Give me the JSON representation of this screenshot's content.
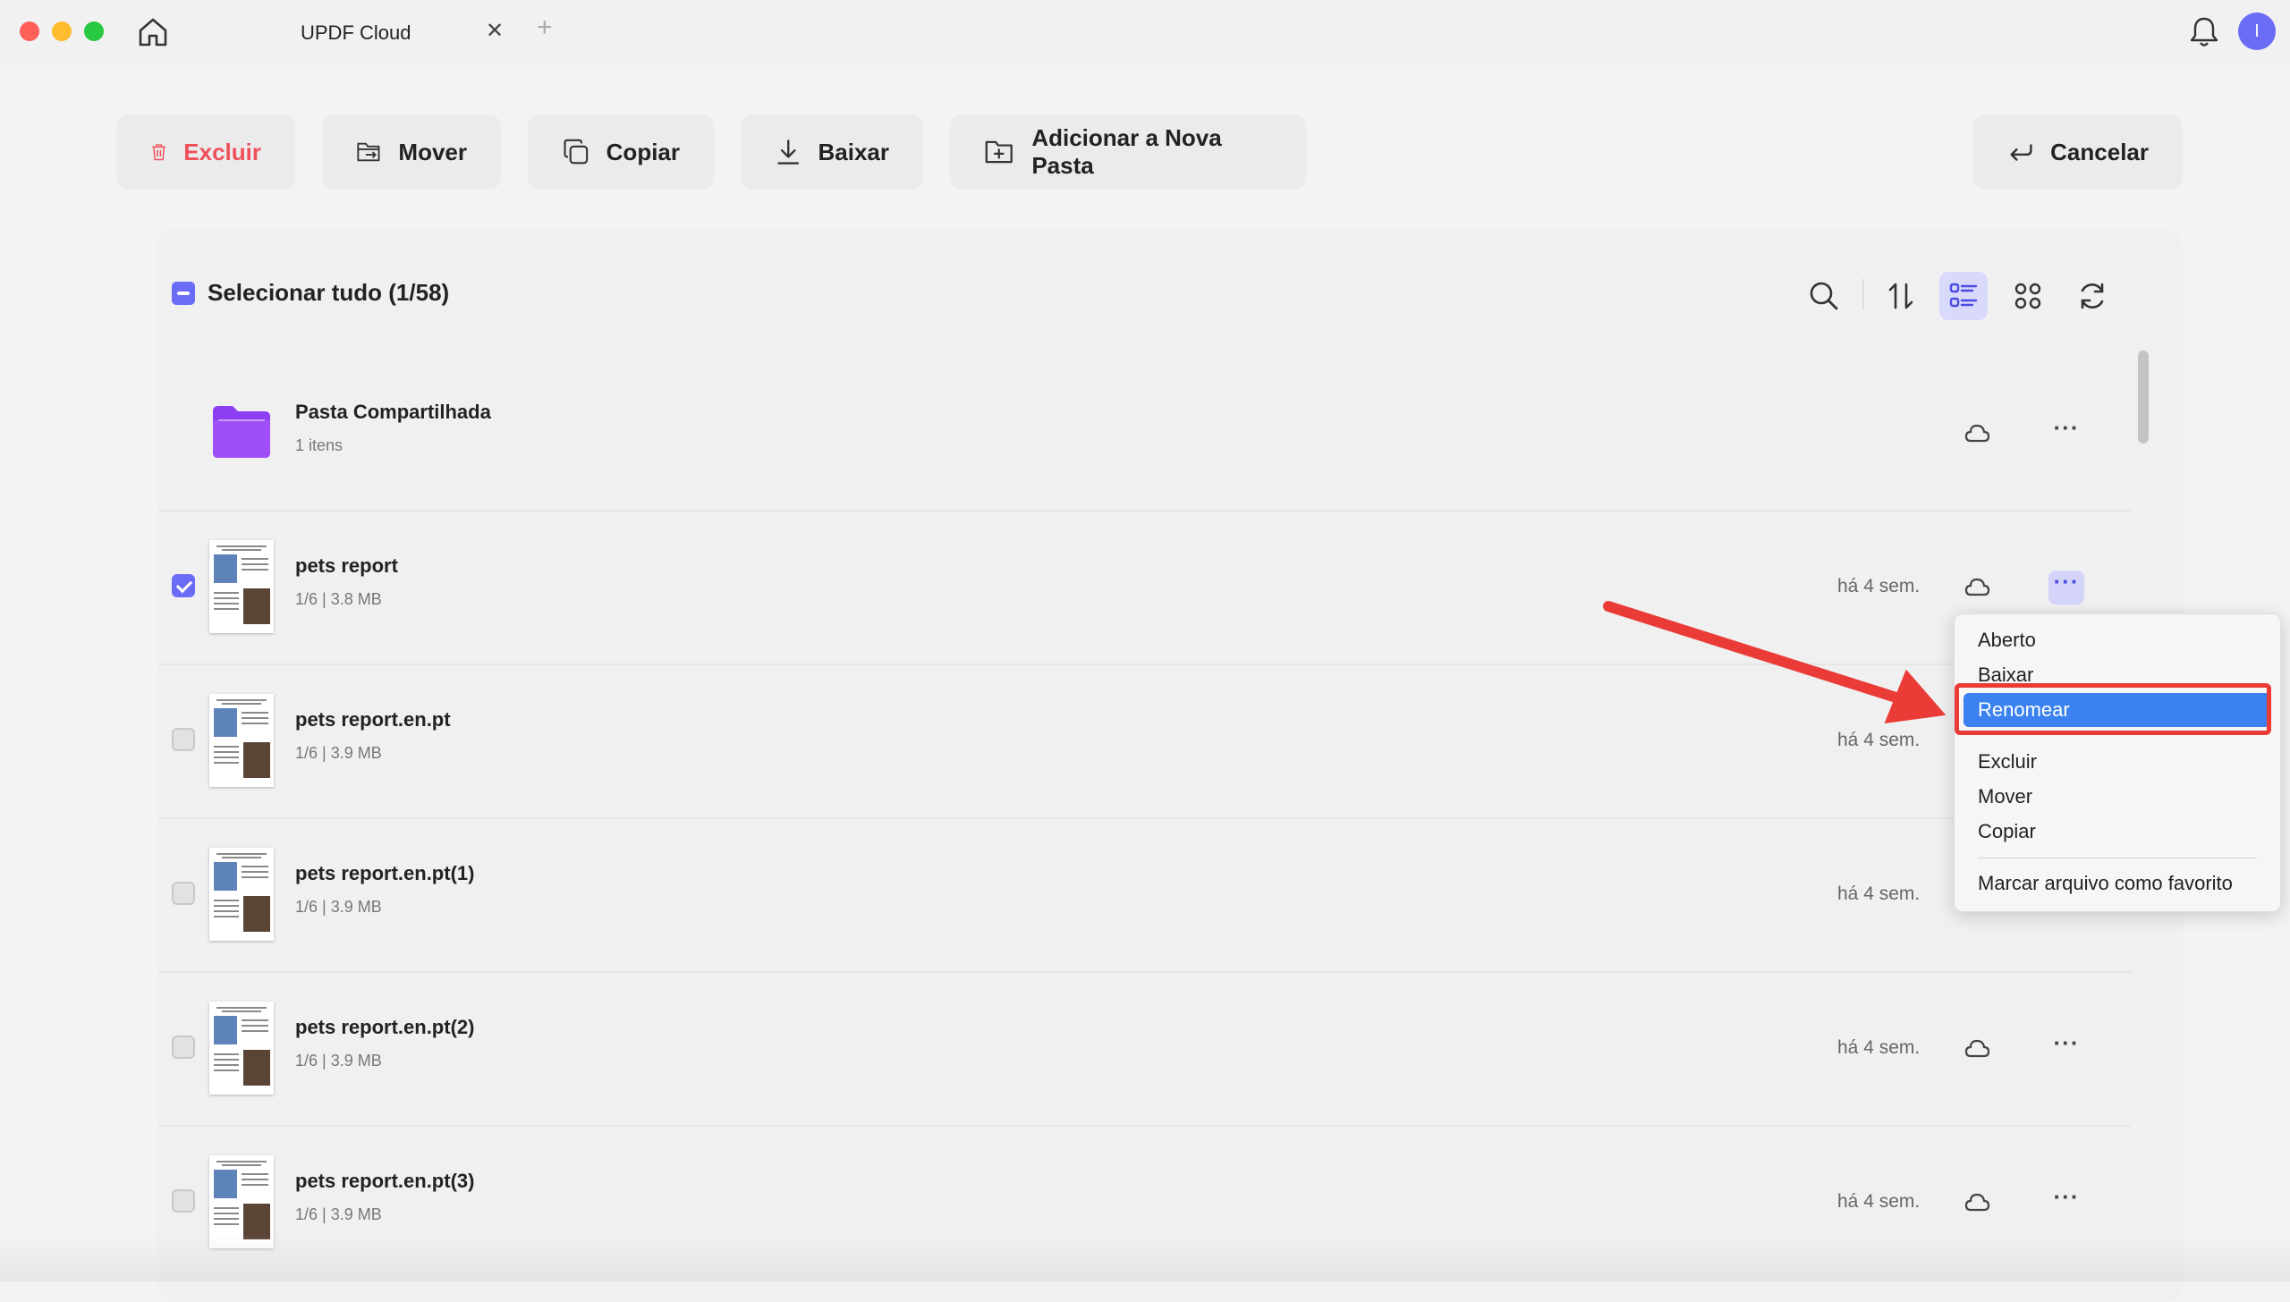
{
  "window": {
    "tab_title": "UPDF Cloud",
    "tab_close": "✕",
    "tab_add": "+",
    "avatar_letter": "I"
  },
  "toolbar": {
    "delete_label": "Excluir",
    "move_label": "Mover",
    "copy_label": "Copiar",
    "download_label": "Baixar",
    "new_folder_label": "Adicionar a Nova Pasta",
    "cancel_label": "Cancelar"
  },
  "list_header": {
    "select_all_label": "Selecionar tudo (1/58)",
    "view_mode": "list"
  },
  "files": [
    {
      "type": "folder",
      "name": "Pasta Compartilhada",
      "meta": "1 itens",
      "date": "",
      "checked": false
    },
    {
      "type": "pdf",
      "name": "pets report",
      "meta": "1/6 | 3.8 MB",
      "date": "há 4 sem.",
      "checked": true,
      "menu_open": true
    },
    {
      "type": "pdf",
      "name": "pets report.en.pt",
      "meta": "1/6 | 3.9 MB",
      "date": "há 4 sem.",
      "checked": false
    },
    {
      "type": "pdf",
      "name": "pets report.en.pt(1)",
      "meta": "1/6 | 3.9 MB",
      "date": "há 4 sem.",
      "checked": false
    },
    {
      "type": "pdf",
      "name": "pets report.en.pt(2)",
      "meta": "1/6 | 3.9 MB",
      "date": "há 4 sem.",
      "checked": false
    },
    {
      "type": "pdf",
      "name": "pets report.en.pt(3)",
      "meta": "1/6 | 3.9 MB",
      "date": "há 4 sem.",
      "checked": false
    }
  ],
  "context_menu": {
    "items": [
      "Aberto",
      "Baixar",
      "Renomear",
      "Excluir",
      "Mover",
      "Copiar",
      "Marcar arquivo como favorito"
    ],
    "highlighted": "Renomear"
  },
  "colors": {
    "accent": "#6b6cf5",
    "danger": "#f0505a",
    "menu_selection": "#3b82f0",
    "annotation_red": "#ea3b37"
  }
}
